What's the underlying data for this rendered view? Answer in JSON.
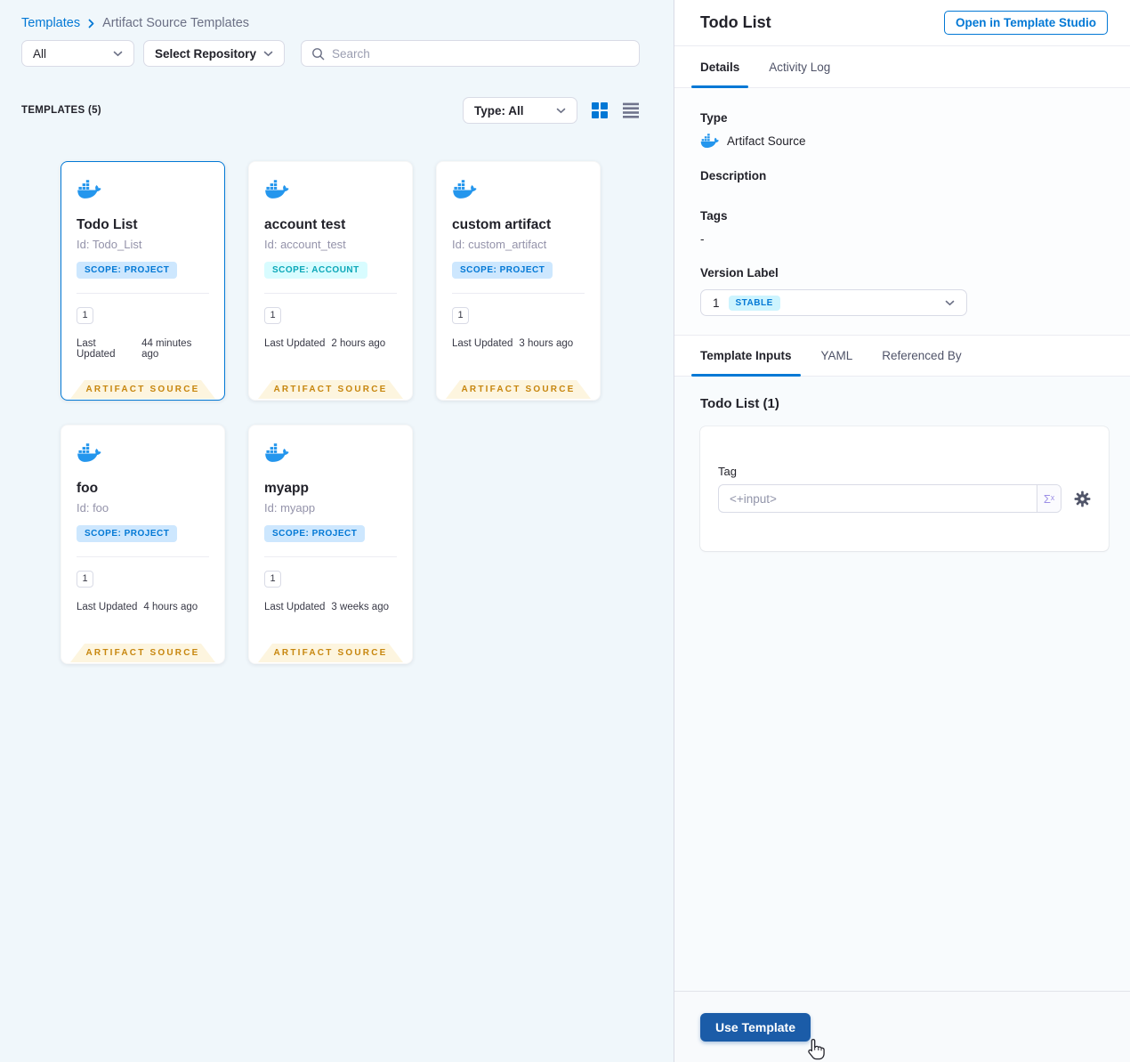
{
  "breadcrumb": {
    "root": "Templates",
    "current": "Artifact Source Templates"
  },
  "filters": {
    "scope_dropdown": "All",
    "repository_dropdown": "Select Repository",
    "search_placeholder": "Search"
  },
  "templates_header": {
    "label": "TEMPLATES (5)",
    "type_filter": "Type: All"
  },
  "card_labels": {
    "last_updated_label": "Last Updated",
    "ribbon": "ARTIFACT SOURCE"
  },
  "cards": [
    {
      "title": "Todo List",
      "id": "Id: Todo_List",
      "scope": "SCOPE: PROJECT",
      "scope_type": "project",
      "version": "1",
      "last_updated": "44 minutes ago",
      "selected": true
    },
    {
      "title": "account test",
      "id": "Id: account_test",
      "scope": "SCOPE: ACCOUNT",
      "scope_type": "account",
      "version": "1",
      "last_updated": "2 hours ago",
      "selected": false
    },
    {
      "title": "custom artifact",
      "id": "Id: custom_artifact",
      "scope": "SCOPE: PROJECT",
      "scope_type": "project",
      "version": "1",
      "last_updated": "3 hours ago",
      "selected": false
    },
    {
      "title": "foo",
      "id": "Id: foo",
      "scope": "SCOPE: PROJECT",
      "scope_type": "project",
      "version": "1",
      "last_updated": "4 hours ago",
      "selected": false
    },
    {
      "title": "myapp",
      "id": "Id: myapp",
      "scope": "SCOPE: PROJECT",
      "scope_type": "project",
      "version": "1",
      "last_updated": "3 weeks ago",
      "selected": false
    }
  ],
  "details_panel": {
    "title": "Todo List",
    "open_studio_button": "Open in Template Studio",
    "tabs": [
      "Details",
      "Activity Log"
    ],
    "type_label": "Type",
    "type_value": "Artifact Source",
    "description_label": "Description",
    "tags_label": "Tags",
    "tags_value": "-",
    "version_label": "Version Label",
    "version_value": "1",
    "version_badge": "STABLE",
    "sub_tabs": [
      "Template Inputs",
      "YAML",
      "Referenced By"
    ],
    "inputs_title": "Todo List (1)",
    "tag_label": "Tag",
    "tag_value": "<+input>",
    "expression_button": "Σˣ",
    "use_template_button": "Use Template"
  },
  "colors": {
    "primary_blue": "#0278d5",
    "docker_blue": "#2496ed",
    "ribbon_bg": "#fdf5df",
    "ribbon_text": "#c7860e",
    "scope_project_bg": "#cde7fe",
    "scope_project_text": "#0278d5",
    "scope_account_bg": "#d8fcff",
    "scope_account_text": "#0ba7b8",
    "stable_badge_bg": "#cdf4fe",
    "use_template_bg": "#1b5ca8",
    "left_panel_bg": "#f0f7fb"
  }
}
